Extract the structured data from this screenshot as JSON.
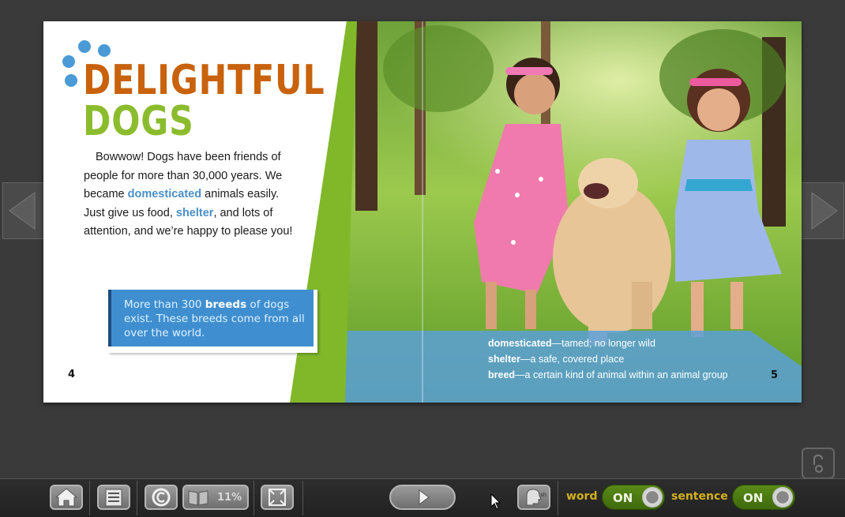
{
  "page_left": {
    "title_line1": "DELIGHTFUL",
    "title_line2": "DOGS",
    "body_lines": [
      "Bowwow! Dogs have been friends of",
      "people for more than 30,000 years. We"
    ],
    "body_line3_pre": "became ",
    "body_line3_kw": "domesticated",
    "body_line3_post": " animals easily.",
    "body_line4_pre": "Just give us food, ",
    "body_line4_kw": "shelter",
    "body_line4_post": ", and lots of",
    "body_line5": "attention, and we’re happy to please you!",
    "callout_pre": "More than 300 ",
    "callout_kw": "breeds",
    "callout_post": " of dogs exist. These breeds come from all over the world.",
    "page_number": "4"
  },
  "page_right": {
    "glossary": [
      {
        "term": "domesticated",
        "def": "—tamed; no longer wild"
      },
      {
        "term": "shelter",
        "def": "—a safe, covered place"
      },
      {
        "term": "breed",
        "def": "—a certain kind of animal within an animal group"
      }
    ],
    "page_number": "5"
  },
  "toolbar": {
    "progress_percent": "11%",
    "word_label": "word",
    "word_toggle": "ON",
    "sentence_label": "sentence",
    "sentence_toggle": "ON"
  },
  "icons": {
    "home": "home-icon",
    "toc": "table-of-contents-icon",
    "copyright": "copyright-icon",
    "book": "book-progress-icon",
    "fullscreen": "fullscreen-icon",
    "play": "play-icon",
    "audio": "speaking-head-icon",
    "lock": "lock-icon",
    "prev": "arrow-left-icon",
    "next": "arrow-right-icon"
  },
  "colors": {
    "title_orange": "#c8620c",
    "title_green": "#8bbc2e",
    "keyword_blue": "#4a8fc9",
    "callout_blue": "#3f8fd0",
    "toggle_green": "#4e7c14",
    "toggle_label_gold": "#d4b01c"
  }
}
